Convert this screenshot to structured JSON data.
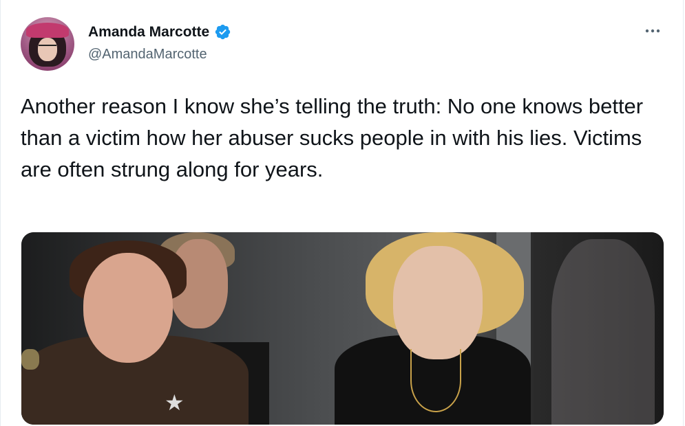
{
  "tweet": {
    "author_name": "Amanda Marcotte",
    "author_handle": "@AmandaMarcotte",
    "verified": true,
    "more_icon": "more-horizontal-icon",
    "text": "Another reason I know she’s telling the truth: No one knows better than a victim how her abuser sucks people in with his lies. Victims are often strung along for years."
  },
  "colors": {
    "text": "#0f1419",
    "secondary": "#536471",
    "verified_blue": "#1d9bf0"
  }
}
